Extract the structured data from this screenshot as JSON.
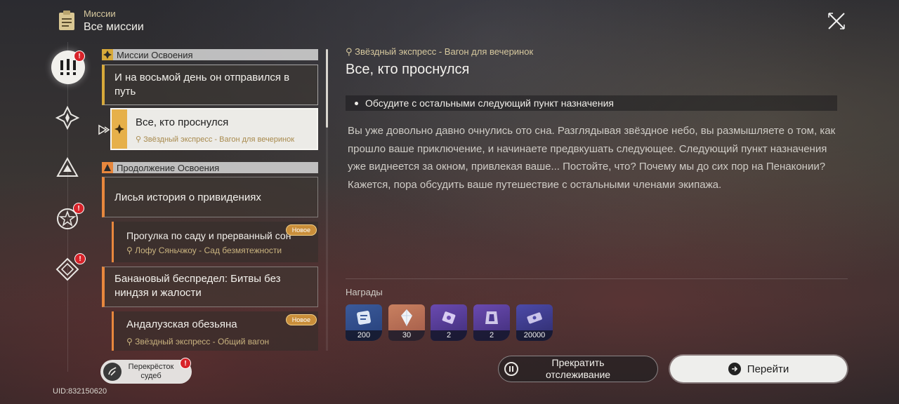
{
  "header": {
    "category": "Миссии",
    "title": "Все миссии"
  },
  "sections": [
    {
      "label": "Миссии Освоения"
    },
    {
      "label": "Продолжение Освоения"
    }
  ],
  "missions": {
    "m1": {
      "title": "И на восьмой день он отправился в путь"
    },
    "m2": {
      "title": "Все, кто проснулся",
      "location": "Звёздный экспресс - Вагон для вечеринок"
    },
    "m3": {
      "title": "Лисья история о привидениях"
    },
    "m4": {
      "title": "Прогулка по саду и прерванный сон",
      "location": "Лофу Сяньчжоу - Сад безмятежности",
      "badge": "Новое"
    },
    "m5": {
      "title": "Банановый беспредел: Битвы без ниндзя и жалости"
    },
    "m6": {
      "title": "Андалузская обезьяна",
      "location": "Звёздный экспресс - Общий вагон",
      "badge": "Новое"
    }
  },
  "crossroads": {
    "label": "Перекрёсток судеб"
  },
  "uid": "UID:832150620",
  "detail": {
    "location": "Звёздный экспресс - Вагон для вечеринок",
    "title": "Все, кто проснулся",
    "objective": "Обсудите с остальными следующий пункт назначения",
    "description_1": "Вы уже довольно давно очнулись ото сна. Разглядывая звёздное небо, вы размышляете о том, как прошло ваше приключение, и начинаете предвкушать следующее. Следующий пункт назначения уже виднеется за окном, привлекая ваше... Постойте, что? Почему мы до сих пор на Пенаконии?",
    "description_2": "Кажется, пора обсудить ваше путешествие с остальными членами экипажа.",
    "rewards_label": "Награды",
    "rewards": [
      {
        "qty": "200",
        "icon": "trailblaze-exp-icon"
      },
      {
        "qty": "30",
        "icon": "stellar-jade-icon"
      },
      {
        "qty": "2",
        "icon": "exp-material-icon"
      },
      {
        "qty": "2",
        "icon": "refinement-material-icon"
      },
      {
        "qty": "20000",
        "icon": "credit-icon"
      }
    ]
  },
  "buttons": {
    "stop": "Прекратить отслеживание",
    "go": "Перейти"
  },
  "colors": {
    "gold": "#d7a93a",
    "orange": "#e7873d",
    "alert": "#d8232a"
  }
}
